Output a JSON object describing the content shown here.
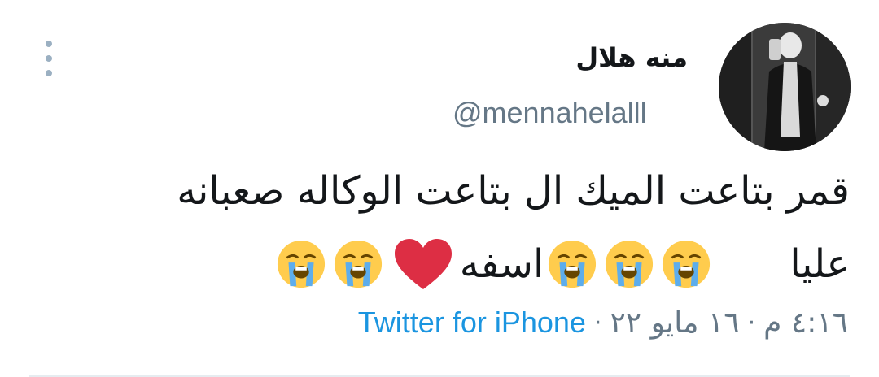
{
  "user": {
    "display_name": "منه هلال",
    "handle": "@mennahelalll",
    "avatar_icon": "profile-photo"
  },
  "tweet": {
    "line1": "قمر بتاعت الميك ال بتاعت الوكاله صعبانه",
    "line2_word1": "عليا",
    "line2_word2": "اسفه",
    "emoji": "loudly-crying-face",
    "heart": "red-heart"
  },
  "meta": {
    "time": "٤:١٦ م",
    "separator": "·",
    "date": "١٦ مايو ٢٢",
    "source": "Twitter for iPhone"
  },
  "colors": {
    "text": "#14171a",
    "muted": "#657786",
    "link": "#1b95e0",
    "heart": "#dd2e44",
    "emoji_face": "#ffcc4d",
    "tears": "#5dadec"
  }
}
